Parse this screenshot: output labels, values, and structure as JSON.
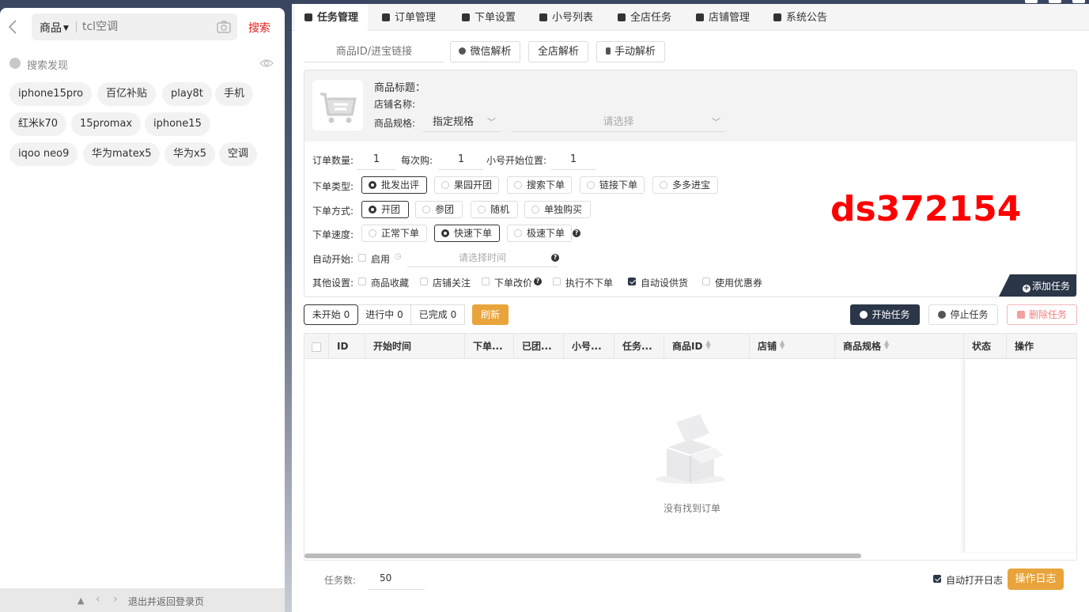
{
  "search": {
    "category": "商品",
    "placeholder": "tcl空调",
    "button": "搜索"
  },
  "discover": {
    "title": "搜索发现",
    "tags": [
      "iphone15pro",
      "百亿补贴",
      "play8t",
      "手机",
      "红米k70",
      "15promax",
      "iphone15",
      "iqoo neo9",
      "华为matex5",
      "华为x5",
      "空调"
    ]
  },
  "left_footer": {
    "exit": "退出并返回登录页"
  },
  "nav": {
    "tabs": [
      "任务管理",
      "订单管理",
      "下单设置",
      "小号列表",
      "全店任务",
      "店铺管理",
      "系统公告"
    ],
    "active": "任务管理"
  },
  "parse": {
    "input_placeholder": "商品ID/进宝链接",
    "wechat": "微信解析",
    "shop": "全店解析",
    "manual": "手动解析"
  },
  "product": {
    "title_label": "商品标题：",
    "store_label": "店铺名称:",
    "spec_label": "商品规格:",
    "spec_value": "指定规格",
    "option_placeholder": "请选择"
  },
  "order": {
    "qty_label": "订单数量:",
    "qty": "1",
    "per_label": "每次购:",
    "per": "1",
    "start_label": "小号开始位置:",
    "start": "1",
    "type_label": "下单类型:",
    "types": [
      "批发出评",
      "果园开团",
      "搜索下单",
      "链接下单",
      "多多进宝"
    ],
    "method_label": "下单方式:",
    "methods": [
      "开团",
      "参团",
      "随机",
      "单独购买"
    ],
    "speed_label": "下单速度:",
    "speeds": [
      "正常下单",
      "快速下单",
      "极速下单"
    ],
    "auto_label": "自动开始:",
    "auto_enable": "启用",
    "time_placeholder": "请选择时间",
    "other_label": "其他设置:",
    "others": [
      "商品收藏",
      "店铺关注",
      "下单改价",
      "执行不下单",
      "自动设供货",
      "使用优惠券"
    ]
  },
  "watermark": "ds372154",
  "add_task": "添加任务",
  "status": {
    "tabs": [
      "未开始 0",
      "进行中 0",
      "已完成 0"
    ],
    "refresh": "刷新",
    "start": "开始任务",
    "stop": "停止任务",
    "delete": "删除任务"
  },
  "table": {
    "columns": [
      "ID",
      "开始时间",
      "下单...",
      "已团...",
      "小号...",
      "任务...",
      "商品ID",
      "店铺",
      "商品规格",
      "状态",
      "操作"
    ],
    "empty": "没有找到订单"
  },
  "footer": {
    "count_label": "任务数:",
    "count": "50",
    "auto_log": "自动打开日志",
    "log_button": "操作日志"
  }
}
